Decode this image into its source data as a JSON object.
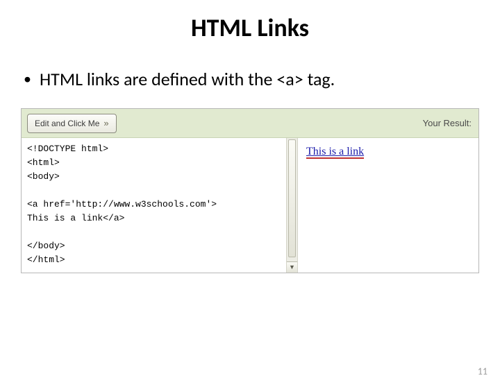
{
  "title": "HTML Links",
  "bullet": "HTML links are defined with the <a> tag.",
  "editor": {
    "button_label": "Edit and Click Me",
    "button_raquo": "»",
    "result_label": "Your Result:",
    "code_lines": "<!DOCTYPE html>\n<html>\n<body>\n\n<a href='http://www.w3schools.com'>\nThis is a link</a>\n\n</body>\n</html>"
  },
  "result": {
    "link_text": "This is a link"
  },
  "page_number": "11"
}
